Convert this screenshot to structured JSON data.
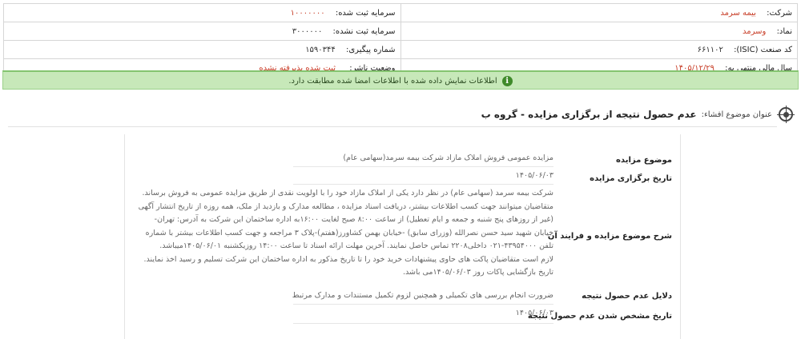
{
  "header": {
    "company_label": "شرکت:",
    "company_value": "بیمه سرمد",
    "registered_capital_label": "سرمایه ثبت شده:",
    "registered_capital_value": "۱۰۰۰۰۰۰۰",
    "symbol_label": "نماد:",
    "symbol_value": "وسرمد",
    "unregistered_capital_label": "سرمایه ثبت نشده:",
    "unregistered_capital_value": "۳۰۰۰۰۰۰",
    "isic_label": "کد صنعت (ISIC):",
    "isic_value": "۶۶۱۱۰۲",
    "tracking_label": "شماره پیگیری:",
    "tracking_value": "۱۵۹۰۳۴۴",
    "fiscal_year_label": "سال مالی منتهی به:",
    "fiscal_year_value": "۱۴۰۵/۱۲/۲۹",
    "publisher_status_label": "وضعیت ناشر:",
    "publisher_status_value": "ثبت شده پذیرفته نشده"
  },
  "alert": {
    "icon": "info-icon",
    "text": "اطلاعات نمایش داده شده با اطلاعات امضا شده مطابقت دارد."
  },
  "section": {
    "icon": "target-icon",
    "label": "عنوان موضوع افشاء:",
    "title": "عدم حصول نتیجه از برگزاری مزایده - گروه ب"
  },
  "details": {
    "auction_subject_label": "موضوع مزایده",
    "auction_subject_value": "مزایده عمومی فروش املاک مازاد شرکت بیمه سرمد(سهامی عام)",
    "auction_date_label": "تاریخ برگزاری مزایده",
    "auction_date_value": "۱۴۰۵/۰۶/۰۳",
    "description_label": "شرح موضوع مزایده و فرایند آن",
    "description_lines": [
      "شرکت بیمه سرمد (سهامی عام) در نظر دارد یکی از املاک مازاد خود را با اولویت نقدی از طریق مزایده عمومی به فروش برساند.",
      "متقاضیان میتوانند جهت کسب اطلاعات بیشتر، دریافت اسناد مزایده ، مطالعه مدارک و بازدید از ملک، همه روزه از تاریخ انتشار آگهی",
      "(غیر از روزهای پنج شنبه و جمعه و ایام تعطیل) از ساعت ۸:۰۰ صبح لغایت ۱۶:۰۰به اداره ساختمان این شرکت به آدرس: تهران-",
      "خیابان شهید سید حسن نصرالله (وزرای سابق) -خیابان بهمن کشاورز(هفتم)-پلاک ۳ مراجعه و جهت کسب اطلاعات بیشتر با شماره",
      "تلفن ۴۳۹۵۴۰۰۰-۰۲۱ داخلی۲۲۰۸ تماس حاصل نمایند. آخرین مهلت ارائه اسناد تا ساعت ۱۴:۰۰ روزیکشنبه ۱۴۰۵/۰۶/۰۱میباشد.",
      "لازم است متقاضیان پاکت های حاوی پیشنهادات خرید خود را تا تاریخ مذکور به اداره ساختمان این شرکت تسلیم و رسید اخذ نمایند.",
      "تاریخ بازگشایی پاکات روز ۱۴۰۵/۰۶/۰۳می باشد."
    ],
    "failure_reasons_label": "دلایل عدم حصول نتیجه",
    "failure_reasons_value": "ضرورت انجام بررسی های تکمیلی و همچنین لزوم تکمیل مستندات و مدارک مرتبط",
    "failure_date_label": "تاریخ مشخص شدن عدم حصول نتیجه",
    "failure_date_value": "۱۴۰۵/۰۶/۰۳"
  }
}
